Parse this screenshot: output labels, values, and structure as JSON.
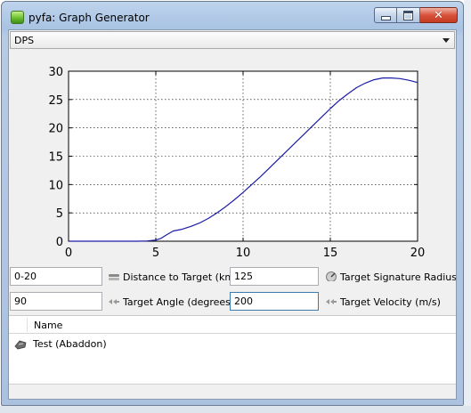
{
  "window": {
    "title": "pyfa: Graph Generator",
    "buttons": {
      "minimize": "minimize",
      "maximize": "maximize",
      "close": "close"
    }
  },
  "graph_selector": {
    "selected": "DPS"
  },
  "chart_data": {
    "type": "line",
    "title": "",
    "xlabel": "",
    "ylabel": "",
    "xlim": [
      0,
      20
    ],
    "ylim": [
      0,
      30
    ],
    "xticks": [
      "0",
      "5",
      "10",
      "15",
      "20"
    ],
    "yticks": [
      "0",
      "5",
      "10",
      "15",
      "20",
      "25",
      "30"
    ],
    "grid": true,
    "series": [
      {
        "color": "#1c1ca6",
        "x": [
          0,
          1,
          2,
          3,
          4,
          4.5,
          5,
          5.3,
          5.6,
          6,
          6.5,
          7,
          7.5,
          8,
          8.5,
          9,
          9.5,
          10,
          10.5,
          11,
          11.5,
          12,
          12.5,
          13,
          13.5,
          14,
          14.5,
          15,
          15.5,
          16,
          16.5,
          17,
          17.5,
          18,
          18.5,
          19,
          19.5,
          20
        ],
        "y": [
          0,
          0,
          0,
          0,
          0,
          0.05,
          0.2,
          0.5,
          1.1,
          1.8,
          2.1,
          2.6,
          3.2,
          4.0,
          5.0,
          6.1,
          7.3,
          8.6,
          10.0,
          11.4,
          12.9,
          14.4,
          15.9,
          17.4,
          18.9,
          20.4,
          21.9,
          23.4,
          24.8,
          26.0,
          27.1,
          27.9,
          28.5,
          28.8,
          28.8,
          28.7,
          28.4,
          28.0
        ]
      }
    ]
  },
  "inputs": {
    "distance": {
      "value": "0-20",
      "label": "Distance to Target (km)",
      "icon": "distance-icon"
    },
    "signature": {
      "value": "125",
      "label": "Target Signature Radius (m)",
      "icon": "signature-radius-icon"
    },
    "angle": {
      "value": "90",
      "label": "Target Angle (degrees)",
      "icon": "angle-icon"
    },
    "velocity": {
      "value": "200",
      "label": "Target Velocity (m/s)",
      "icon": "velocity-icon"
    }
  },
  "fit_list": {
    "column_header": "Name",
    "items": [
      {
        "label": "Test (Abaddon)",
        "icon": "ship-icon"
      }
    ]
  },
  "colors": {
    "line": "#1c1ca6",
    "title_bar": "#b7cbe5",
    "close_button": "#d8523b"
  }
}
